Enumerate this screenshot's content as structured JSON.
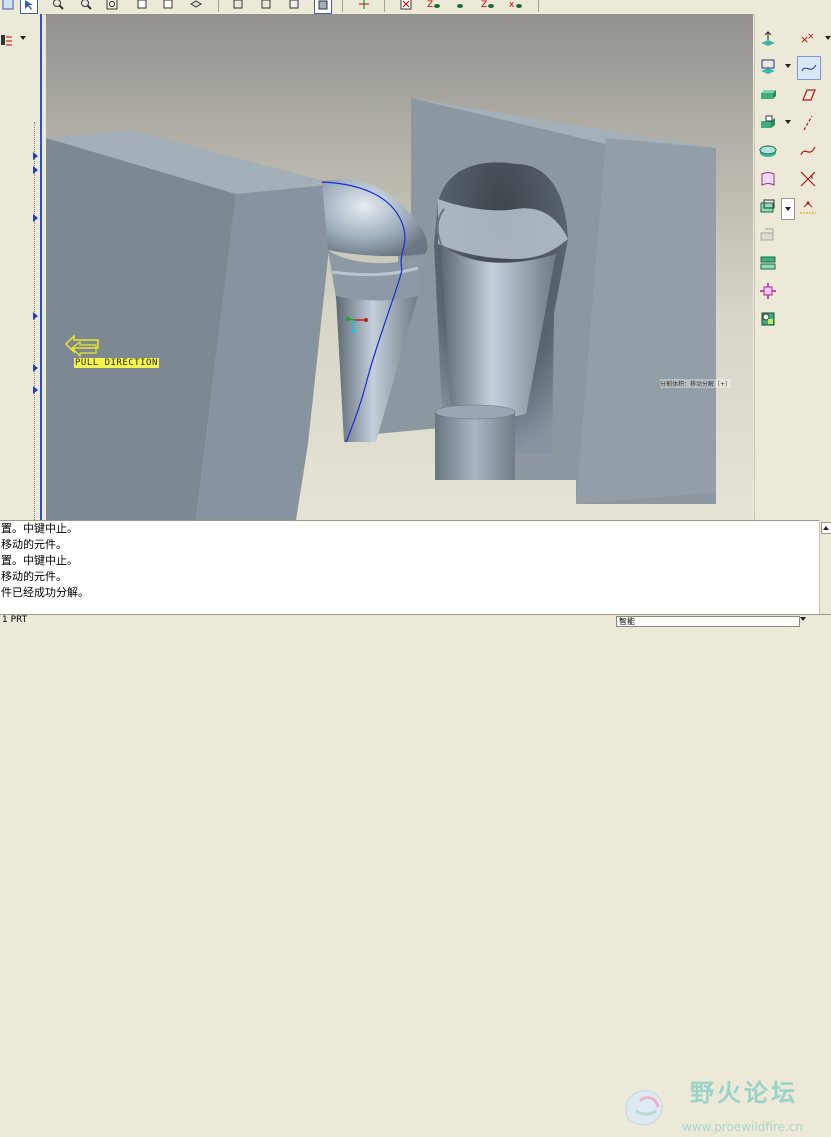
{
  "toolbar": {
    "icons": [
      "new-icon",
      "select-arrow-icon",
      "zoom-in-icon",
      "zoom-out-icon",
      "refit-icon",
      "repaint-icon",
      "view-orient-icon",
      "layers-icon",
      "wireframe-icon",
      "hidden-line-icon",
      "no-hidden-icon",
      "shading-icon",
      "spin-center-icon",
      "close-icon",
      "axis-display-icon",
      "point-display-icon",
      "csys-display-icon",
      "datum-display-icon"
    ]
  },
  "viewport": {
    "pull_direction_label": "PULL DIRECTION",
    "note_text": "分割体积：移动分解（+）"
  },
  "right_toolbar": {
    "icons": [
      "mold-layout-icon",
      "datum-point-icon",
      "refpart-icon",
      "sketch-curve-icon",
      "workpiece-icon",
      "datum-plane-icon",
      "shrinkage-icon",
      "datum-axis-icon",
      "parting-surface-icon",
      "datum-curve-icon",
      "volume-icon",
      "datum-csys-icon",
      "split-volume-icon",
      "datum-analysis-icon",
      "mold-component-icon",
      "feed-system-icon",
      "cast-icon",
      "mold-open-icon"
    ]
  },
  "messages": {
    "lines": [
      "置。中键中止。",
      "移动的元件。",
      "置。中键中止。",
      "移动的元件。",
      "件已经成功分解。"
    ]
  },
  "statusbar": {
    "left_text": "1 PRT",
    "filter_value": "智能"
  },
  "watermark": {
    "title": "野火论坛",
    "url": "www.proewildfire.cn"
  },
  "colors": {
    "selection_blue": "#1a2bd8",
    "model_gray": "#8d98a1",
    "label_yellow": "#f5f54a"
  }
}
